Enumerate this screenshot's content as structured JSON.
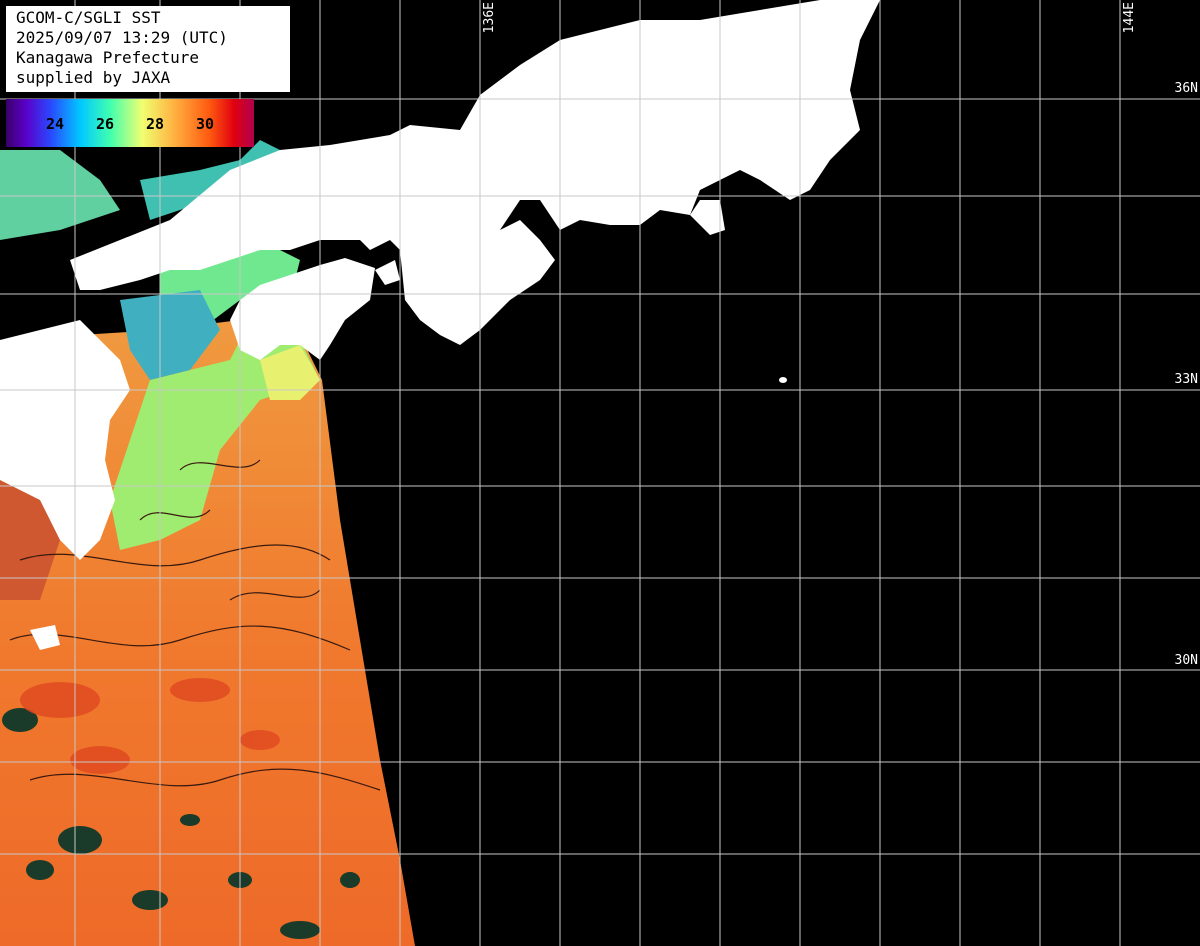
{
  "info": {
    "line1": "GCOM-C/SGLI SST",
    "line2": "2025/09/07 13:29 (UTC)",
    "line3": "Kanagawa Prefecture",
    "line4": "supplied by JAXA"
  },
  "colorbar": {
    "ticks": [
      "24",
      "26",
      "28",
      "30"
    ]
  },
  "grid": {
    "lat_labels": [
      "36N",
      "33N",
      "30N"
    ],
    "lon_labels": [
      "136E",
      "144E"
    ]
  },
  "colors": {
    "ocean_nodata": "#000000",
    "land": "#ffffff",
    "grid": "#c8c8c8",
    "sst_warm": "#f07830",
    "sst_mid": "#d0ff60",
    "sst_cool": "#30e0ff"
  }
}
